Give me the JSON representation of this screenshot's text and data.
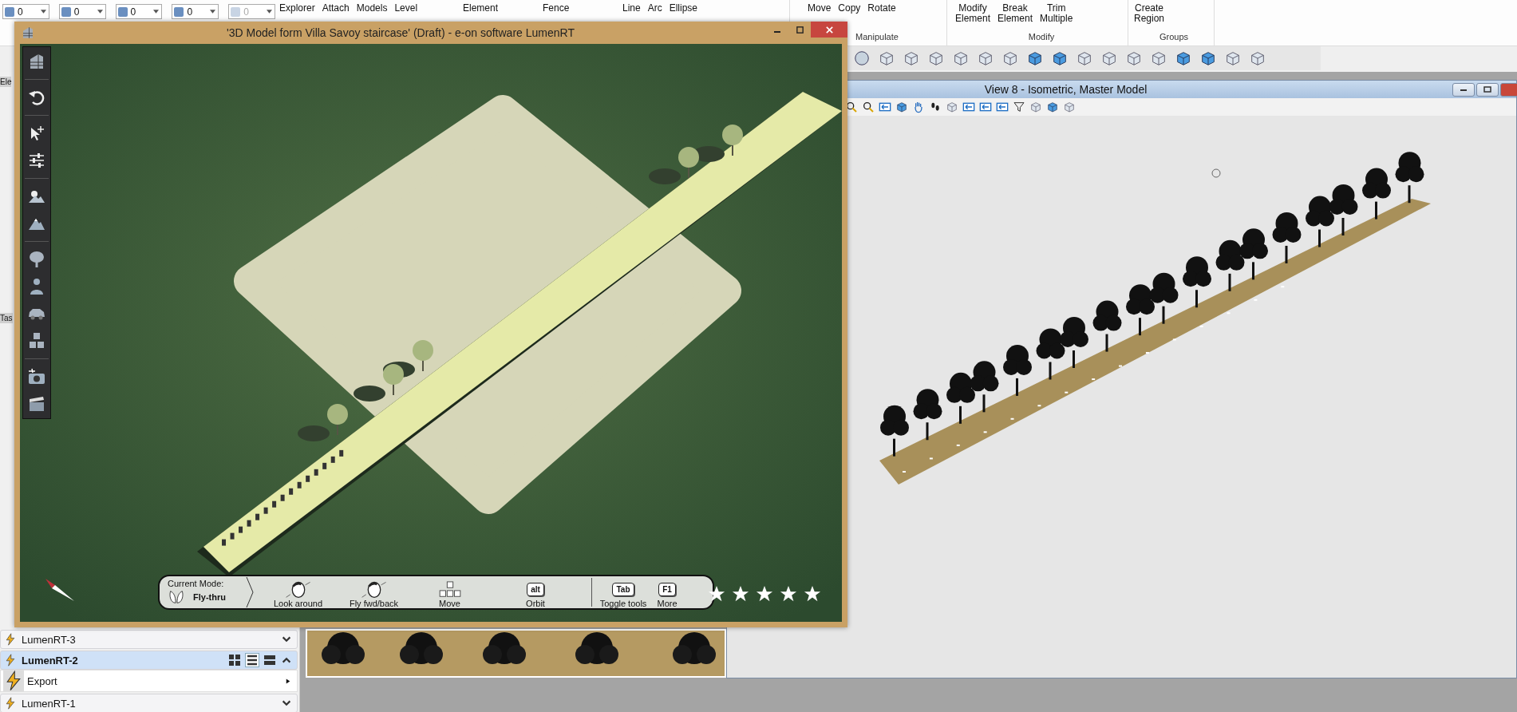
{
  "ribbon": {
    "dropdowns": [
      {
        "value": "0",
        "disabled": false
      },
      {
        "value": "0",
        "disabled": false
      },
      {
        "value": "0",
        "disabled": false
      },
      {
        "value": "0",
        "disabled": false
      },
      {
        "value": "0",
        "disabled": true
      }
    ],
    "groups": [
      {
        "buttons": [
          "Explorer",
          "Attach",
          "Models",
          "Level"
        ]
      },
      {
        "buttons": [
          "Element"
        ]
      },
      {
        "buttons": [
          "Fence"
        ]
      },
      {
        "buttons": [
          "Line",
          "Arc",
          "Ellipse"
        ]
      },
      {
        "label": "Manipulate",
        "buttons": [
          "Move",
          "Copy",
          "Rotate"
        ]
      },
      {
        "label": "Modify",
        "buttons": [
          "Modify Element",
          "Break Element",
          "Trim Multiple"
        ]
      },
      {
        "label": "Groups",
        "buttons": [
          "Create Region"
        ]
      }
    ]
  },
  "side_panel": {
    "stub_labels": [
      "Ele",
      "Tas"
    ],
    "sections": [
      {
        "title": "LumenRT-3",
        "expanded": false
      },
      {
        "title": "LumenRT-2",
        "expanded": true,
        "items": [
          "Export"
        ]
      },
      {
        "title": "LumenRT-1",
        "expanded": false
      }
    ]
  },
  "view_window": {
    "title": "View 8 - Isometric, Master Model"
  },
  "lumen_window": {
    "title": "'3D Model form Villa Savoy staircase' (Draft) - e-on software LumenRT",
    "mode_bar": {
      "label": "Current Mode:",
      "mode": "Fly-thru",
      "actions": [
        {
          "kind": "mouse",
          "label": "Look around"
        },
        {
          "kind": "mouse",
          "label": "Fly fwd/back"
        },
        {
          "kind": "arrows",
          "label": "Move"
        },
        {
          "kind": "key",
          "key": "alt",
          "label": "Orbit"
        },
        {
          "kind": "key",
          "key": "Tab",
          "label": "Toggle tools"
        },
        {
          "kind": "key",
          "key": "F1",
          "label": "More"
        }
      ]
    },
    "stars": 5
  }
}
